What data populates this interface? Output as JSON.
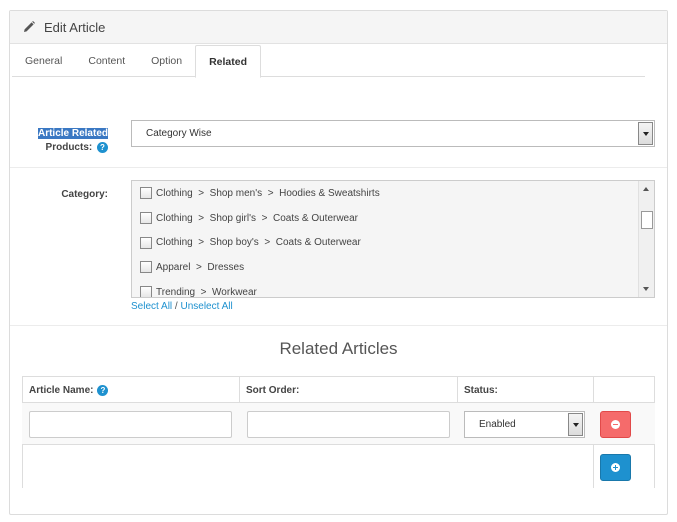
{
  "header": {
    "title": "Edit Article",
    "icon": "pencil-icon"
  },
  "tabs": [
    {
      "label": "General",
      "active": false
    },
    {
      "label": "Content",
      "active": false
    },
    {
      "label": "Option",
      "active": false
    },
    {
      "label": "Related",
      "active": true
    }
  ],
  "related_products": {
    "label_line1": "Article Related",
    "label_line2": "Products:",
    "help_glyph": "?",
    "selected": "Category Wise"
  },
  "category": {
    "label": "Category:",
    "items": [
      {
        "label": "Clothing  >  Shop men's  >  Hoodies & Sweatshirts",
        "checked": false
      },
      {
        "label": "Clothing  >  Shop girl's  >  Coats & Outerwear",
        "checked": false
      },
      {
        "label": "Clothing  >  Shop boy's  >  Coats & Outerwear",
        "checked": false
      },
      {
        "label": "Apparel  >  Dresses",
        "checked": false
      },
      {
        "label": "Trending  >  Workwear",
        "checked": false
      }
    ],
    "select_all": "Select All",
    "separator": "/",
    "unselect_all": "Unselect All"
  },
  "related_articles": {
    "title": "Related Articles",
    "columns": {
      "name": "Article Name:",
      "sort": "Sort Order:",
      "status": "Status:"
    },
    "row": {
      "name_value": "",
      "sort_value": "",
      "status": "Enabled"
    }
  },
  "colors": {
    "primary": "#1e91cf",
    "danger": "#f56b6b",
    "selection": "#3a78c3"
  }
}
